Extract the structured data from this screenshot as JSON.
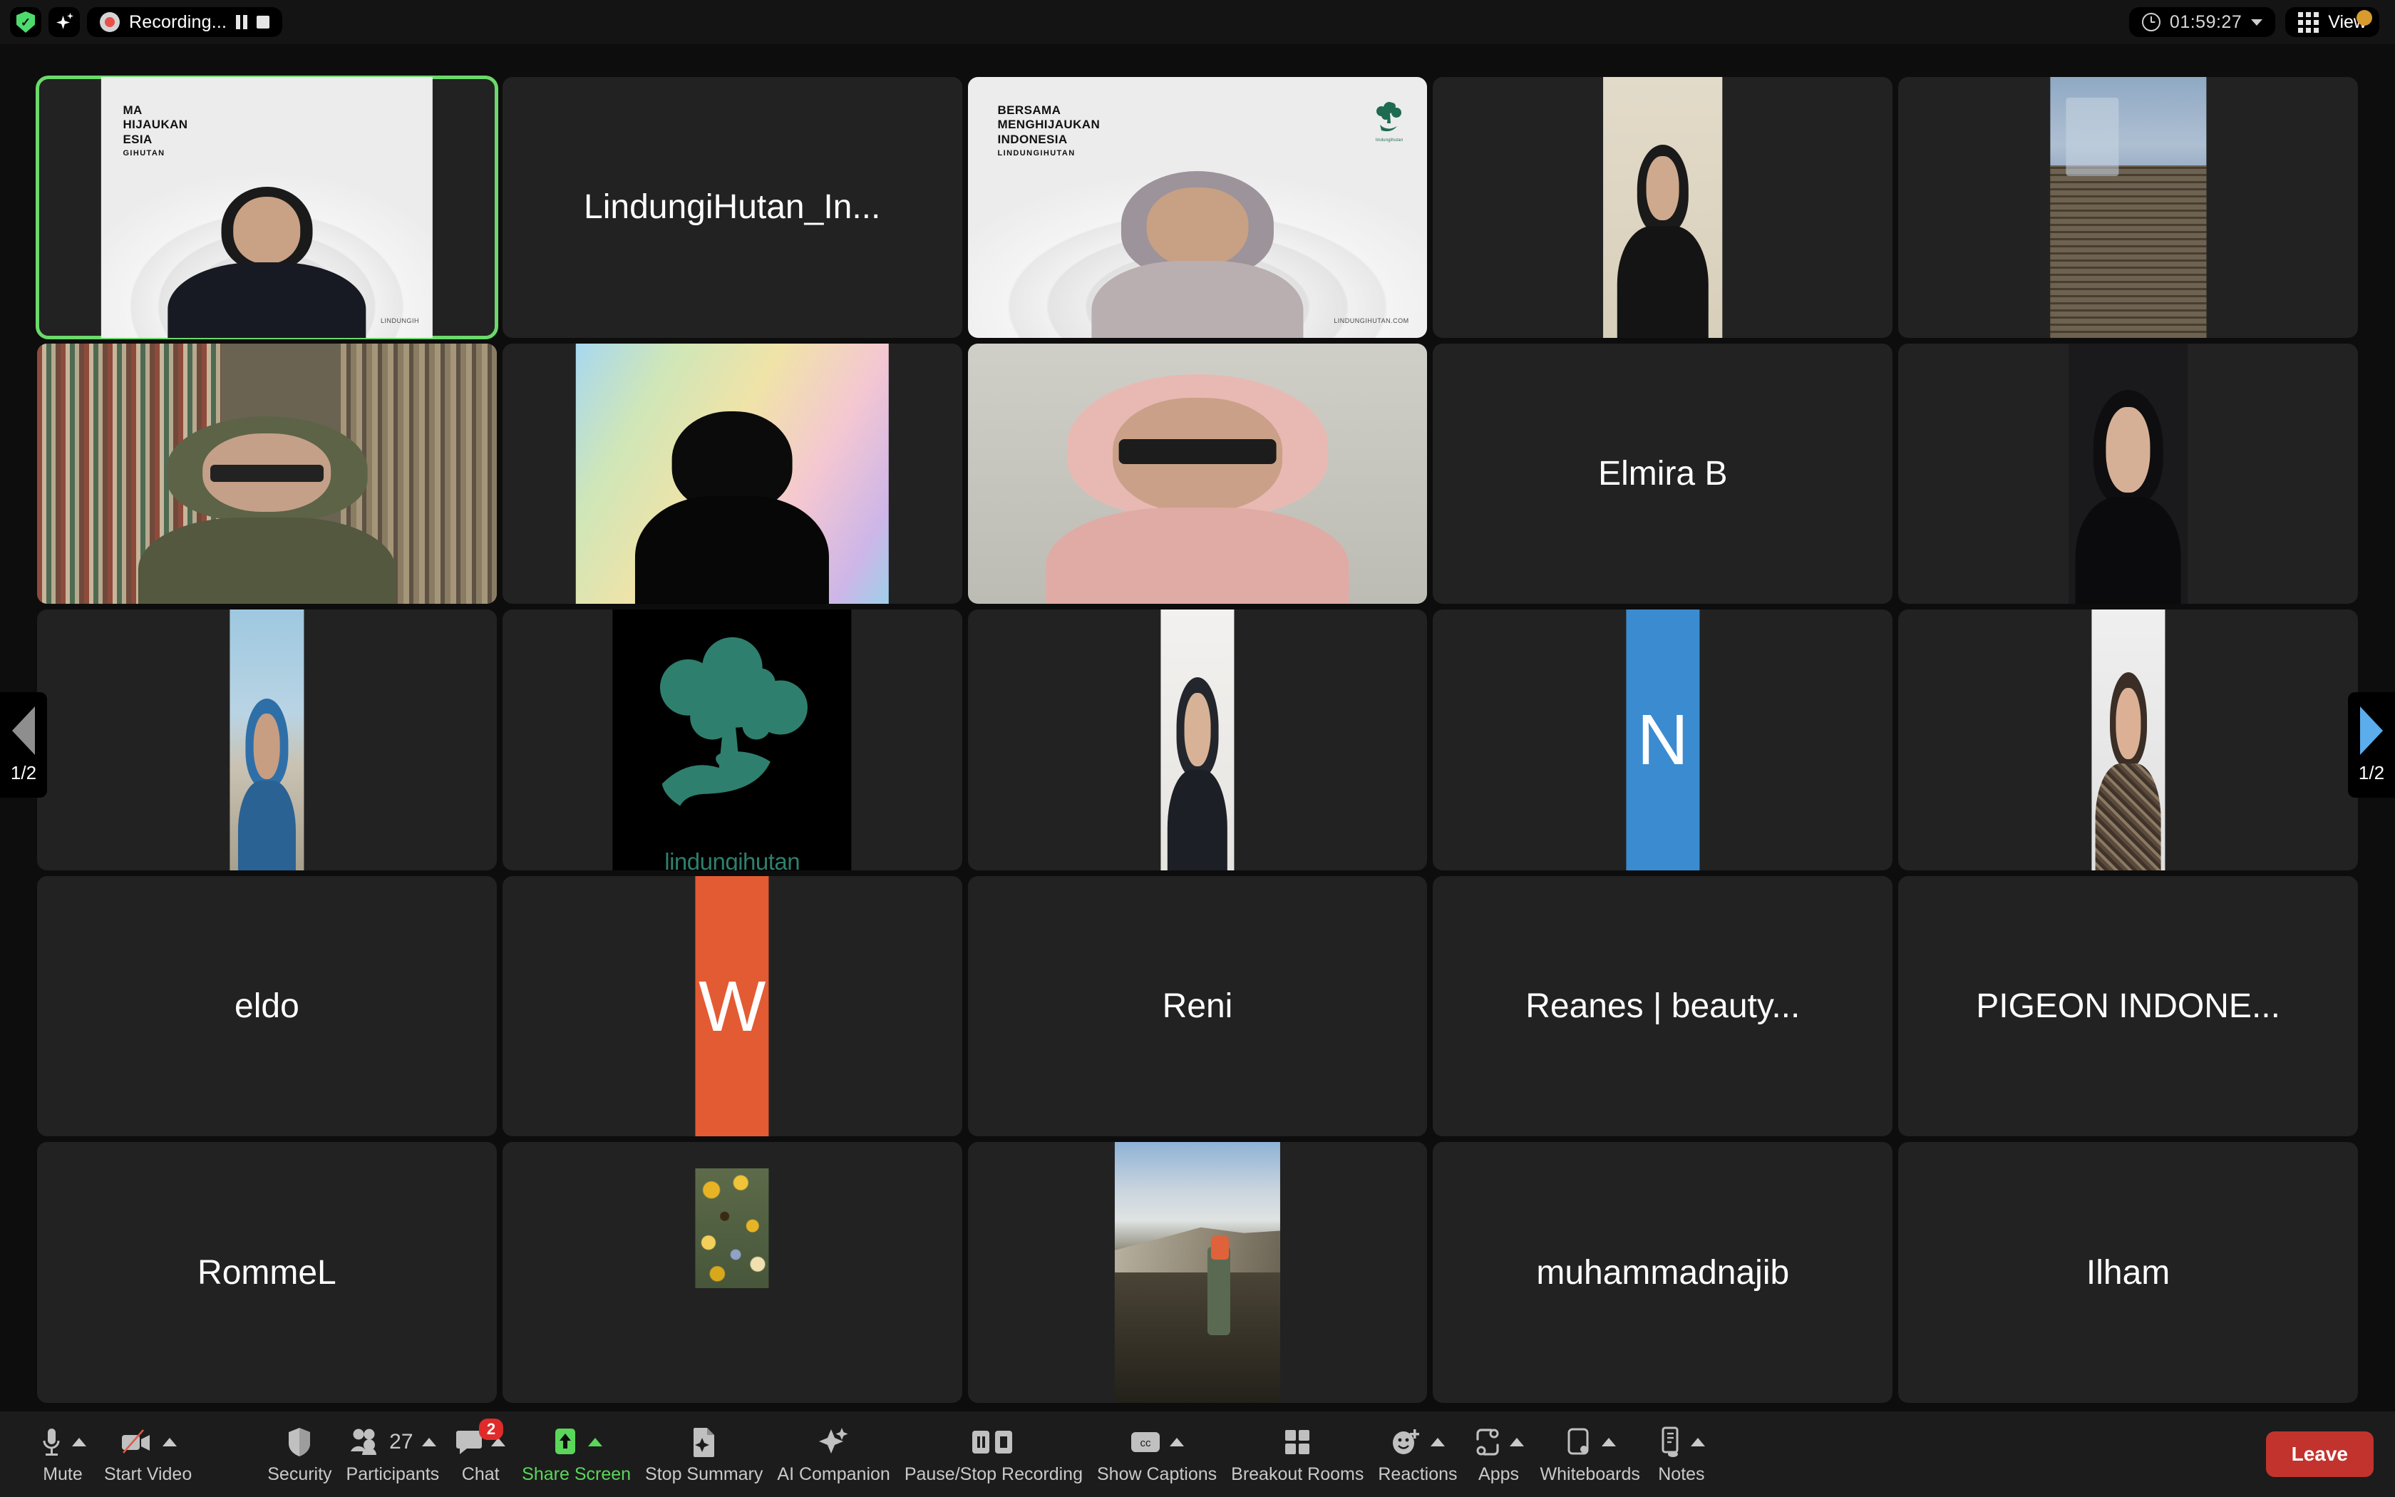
{
  "app": {
    "name": "Zoom Meeting",
    "background": "#0d0d0d",
    "tile_bg": "#222222",
    "active_border": "#6bd96b"
  },
  "topbar": {
    "encryption_icon": "shield-check-icon",
    "ai_icon": "sparkle-icon",
    "recording": {
      "icon": "record-dot-icon",
      "label": "Recording...",
      "pause_icon": "pause-icon",
      "stop_icon": "stop-icon"
    },
    "timer": {
      "icon": "clock-icon",
      "value": "01:59:27",
      "chevron": "chevron-down-icon"
    },
    "view": {
      "icon": "grid-view-icon",
      "label": "View",
      "notification_color": "#d79b2e"
    }
  },
  "pagination": {
    "prev": {
      "icon": "triangle-left-icon",
      "label": "1/2",
      "color": "#8e8e8e"
    },
    "next": {
      "icon": "triangle-right-icon",
      "label": "1/2",
      "color": "#5badeb"
    }
  },
  "grid": {
    "columns": 5,
    "rows": 5,
    "tiles": [
      {
        "id": "t1",
        "name": "",
        "kind": "video-lh",
        "active": true,
        "lh_line1": "MA",
        "lh_line2": "HIJAUKAN",
        "lh_line3": "ESIA",
        "lh_sub": "GIHUTAN",
        "lh_foot": "LINDUNGIH",
        "skin": "#c9a184",
        "cloth": "#171a22"
      },
      {
        "id": "t2",
        "name": "LindungiHutan_In...",
        "kind": "name"
      },
      {
        "id": "t3",
        "name": "",
        "kind": "video-lh",
        "lh_line1": "BERSAMA",
        "lh_line2": "MENGHIJAUKAN",
        "lh_line3": "INDONESIA",
        "lh_sub": "LINDUNGIHUTAN",
        "lh_foot": "LINDUNGIHUTAN.COM",
        "skin": "#c8a084",
        "cloth": "#b9aeb0",
        "logo": true
      },
      {
        "id": "t4",
        "name": "",
        "kind": "photo-portrait-hijab-cream"
      },
      {
        "id": "t5",
        "name": "",
        "kind": "photo-building"
      },
      {
        "id": "t6",
        "name": "",
        "kind": "video-bookshelf"
      },
      {
        "id": "t7",
        "name": "",
        "kind": "video-dark-gradient"
      },
      {
        "id": "t8",
        "name": "",
        "kind": "video-headset-hijab"
      },
      {
        "id": "t9",
        "name": "Elmira B",
        "kind": "name"
      },
      {
        "id": "t10",
        "name": "",
        "kind": "photo-portrait-dark-hijab"
      },
      {
        "id": "t11",
        "name": "",
        "kind": "photo-blue-hijab"
      },
      {
        "id": "t12",
        "name": "",
        "kind": "logo-lindungihutan",
        "logo_text": "lindungihutan",
        "logo_color": "#2f7f6e"
      },
      {
        "id": "t13",
        "name": "",
        "kind": "photo-portrait-white"
      },
      {
        "id": "t14",
        "name": "",
        "kind": "avatar-letter",
        "letter": "N",
        "color": "#3b8bd0"
      },
      {
        "id": "t15",
        "name": "",
        "kind": "photo-portrait-floral"
      },
      {
        "id": "t16",
        "name": "eldo",
        "kind": "name"
      },
      {
        "id": "t17",
        "name": "",
        "kind": "avatar-letter",
        "letter": "W",
        "color": "#e35b33"
      },
      {
        "id": "t18",
        "name": "Reni",
        "kind": "name"
      },
      {
        "id": "t19",
        "name": "Reanes | beauty...",
        "kind": "name"
      },
      {
        "id": "t20",
        "name": "PIGEON INDONE...",
        "kind": "name"
      },
      {
        "id": "t21",
        "name": "RommeL",
        "kind": "name"
      },
      {
        "id": "t22",
        "name": "",
        "kind": "photo-flowers"
      },
      {
        "id": "t23",
        "name": "",
        "kind": "photo-mountain-hiker"
      },
      {
        "id": "t24",
        "name": "muhammadnajib",
        "kind": "name"
      },
      {
        "id": "t25",
        "name": "Ilham",
        "kind": "name"
      }
    ]
  },
  "toolbar": {
    "items": [
      {
        "id": "mute",
        "label": "Mute",
        "icon": "microphone-icon",
        "caret": true
      },
      {
        "id": "start-video",
        "label": "Start Video",
        "icon": "video-off-icon",
        "caret": true
      },
      {
        "id": "security",
        "label": "Security",
        "icon": "shield-icon",
        "caret": false
      },
      {
        "id": "participants",
        "label": "Participants",
        "icon": "participants-icon",
        "caret": true,
        "count": "27"
      },
      {
        "id": "chat",
        "label": "Chat",
        "icon": "chat-bubble-icon",
        "caret": true,
        "badge": "2"
      },
      {
        "id": "share-screen",
        "label": "Share Screen",
        "icon": "share-screen-icon",
        "caret": true,
        "highlight": "#5ad65a"
      },
      {
        "id": "stop-summary",
        "label": "Stop Summary",
        "icon": "summary-doc-icon",
        "caret": false
      },
      {
        "id": "ai-companion",
        "label": "AI Companion",
        "icon": "sparkle-icon",
        "caret": false
      },
      {
        "id": "pause-stop",
        "label": "Pause/Stop Recording",
        "icon": "pause-stop-icon",
        "caret": false
      },
      {
        "id": "show-captions",
        "label": "Show Captions",
        "icon": "closed-caption-icon",
        "caret": true
      },
      {
        "id": "breakout",
        "label": "Breakout Rooms",
        "icon": "breakout-rooms-icon",
        "caret": false
      },
      {
        "id": "reactions",
        "label": "Reactions",
        "icon": "reactions-icon",
        "caret": true
      },
      {
        "id": "apps",
        "label": "Apps",
        "icon": "apps-icon",
        "caret": true
      },
      {
        "id": "whiteboards",
        "label": "Whiteboards",
        "icon": "whiteboard-icon",
        "caret": true
      },
      {
        "id": "notes",
        "label": "Notes",
        "icon": "notes-icon",
        "caret": true
      }
    ],
    "leave": {
      "label": "Leave",
      "color": "#c2332e"
    }
  }
}
